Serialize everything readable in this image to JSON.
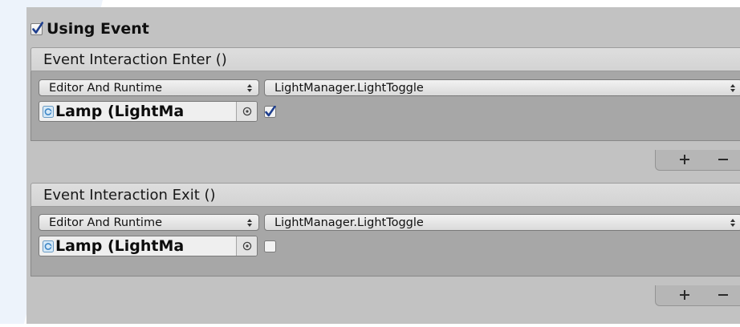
{
  "component": {
    "toggle_label": "Using Event",
    "toggle_checked": true
  },
  "events": [
    {
      "title": "Event Interaction Enter ()",
      "runtime_mode": "Editor And Runtime",
      "function": "LightManager.LightToggle",
      "target_object": "Lamp (LightMa",
      "bool_argument": true
    },
    {
      "title": "Event Interaction Exit ()",
      "runtime_mode": "Editor And Runtime",
      "function": "LightManager.LightToggle",
      "target_object": "Lamp (LightMa",
      "bool_argument": false
    }
  ],
  "icons": {
    "object": "script-icon",
    "picker": "object-picker-icon",
    "dropdown": "dropdown-arrows-icon",
    "add": "plus-icon",
    "remove": "minus-icon"
  },
  "colors": {
    "panel_bg": "#c2c2c2",
    "header_bg": "#d8d8d8",
    "body_bg": "#a7a7a7",
    "checkmark": "#1f3f8e",
    "decoration": "#e7f0fb"
  }
}
